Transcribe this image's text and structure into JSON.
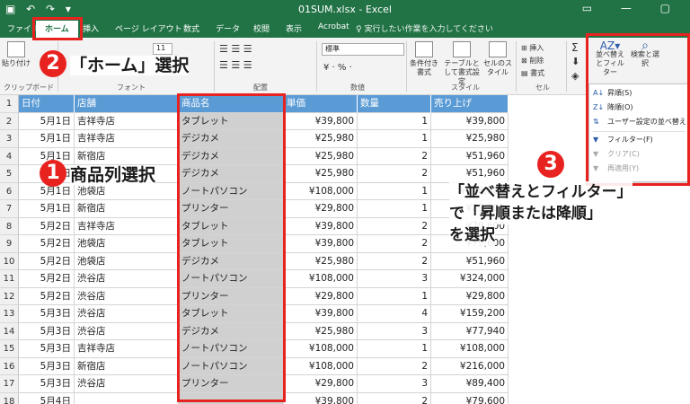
{
  "window": {
    "title": "01SUM.xlsx - Excel"
  },
  "tabs": [
    "ファイル",
    "ホーム",
    "挿入",
    "ページ レイアウト",
    "数式",
    "データ",
    "校閲",
    "表示",
    "Acrobat"
  ],
  "tell_me": "実行したい作業を入力してください",
  "ribbon": {
    "paste": "貼り付け",
    "clipboard": "クリップボード",
    "font": "フォント",
    "font_size": "11",
    "alignment": "配置",
    "number_format": "標準",
    "number": "数値",
    "conditional": "条件付き書式",
    "table_format": "テーブルとして書式設定",
    "cell_style": "セルのスタイル",
    "style": "スタイル",
    "insert": "挿入",
    "delete": "削除",
    "format": "書式",
    "cells": "セル",
    "sort_filter": "並べ替えとフィルター",
    "find_select": "検索と選択"
  },
  "sort_menu": {
    "items": [
      {
        "label": "昇順(S)",
        "icon": "A↓"
      },
      {
        "label": "降順(O)",
        "icon": "Z↓"
      },
      {
        "label": "ユーザー設定の並べ替え",
        "icon": "⇅"
      },
      {
        "label": "フィルター(F)",
        "icon": "▼"
      },
      {
        "label": "クリア(C)",
        "icon": "▼"
      },
      {
        "label": "再適用(Y)",
        "icon": "▼"
      }
    ]
  },
  "annotations": {
    "step1_num": "1",
    "step1": "商品列選択",
    "step2_num": "2",
    "step2": "「ホーム」選択",
    "step3_num": "3",
    "step3_line1": "「並べ替えとフィルター」",
    "step3_line2": "で「昇順または降順」",
    "step3_line3": "を選択"
  },
  "sheet": {
    "headers": [
      "日付",
      "店舗",
      "商品名",
      "単価",
      "数量",
      "売り上げ"
    ],
    "row_numbers": [
      "1",
      "2",
      "3",
      "4",
      "5",
      "6",
      "7",
      "8",
      "9",
      "10",
      "11",
      "12",
      "13",
      "14",
      "15",
      "16",
      "17",
      "18"
    ],
    "rows": [
      [
        "5月1日",
        "吉祥寺店",
        "タブレット",
        "¥39,800",
        "1",
        "¥39,800"
      ],
      [
        "5月1日",
        "吉祥寺店",
        "デジカメ",
        "¥25,980",
        "1",
        "¥25,980"
      ],
      [
        "5月1日",
        "新宿店",
        "デジカメ",
        "¥25,980",
        "2",
        "¥51,960"
      ],
      [
        "5月1日",
        "",
        "デジカメ",
        "¥25,980",
        "2",
        "¥51,960"
      ],
      [
        "5月1日",
        "池袋店",
        "ノートパソコン",
        "¥108,000",
        "1",
        "¥108,000"
      ],
      [
        "5月1日",
        "新宿店",
        "プリンター",
        "¥29,800",
        "1",
        "¥29,800"
      ],
      [
        "5月2日",
        "吉祥寺店",
        "タブレット",
        "¥39,800",
        "2",
        "¥79,600"
      ],
      [
        "5月2日",
        "池袋店",
        "タブレット",
        "¥39,800",
        "2",
        "¥79,600"
      ],
      [
        "5月2日",
        "池袋店",
        "デジカメ",
        "¥25,980",
        "2",
        "¥51,960"
      ],
      [
        "5月2日",
        "渋谷店",
        "ノートパソコン",
        "¥108,000",
        "3",
        "¥324,000"
      ],
      [
        "5月2日",
        "渋谷店",
        "プリンター",
        "¥29,800",
        "1",
        "¥29,800"
      ],
      [
        "5月3日",
        "渋谷店",
        "タブレット",
        "¥39,800",
        "4",
        "¥159,200"
      ],
      [
        "5月3日",
        "渋谷店",
        "デジカメ",
        "¥25,980",
        "3",
        "¥77,940"
      ],
      [
        "5月3日",
        "吉祥寺店",
        "ノートパソコン",
        "¥108,000",
        "1",
        "¥108,000"
      ],
      [
        "5月3日",
        "新宿店",
        "ノートパソコン",
        "¥108,000",
        "2",
        "¥216,000"
      ],
      [
        "5月3日",
        "渋谷店",
        "プリンター",
        "¥29,800",
        "3",
        "¥89,400"
      ],
      [
        "5月4日",
        "",
        "",
        "¥39,800",
        "2",
        "¥79,600"
      ]
    ]
  },
  "colors": {
    "excel_green": "#217346",
    "header_blue": "#5b9bd5",
    "annotation_red": "#e8231f"
  }
}
